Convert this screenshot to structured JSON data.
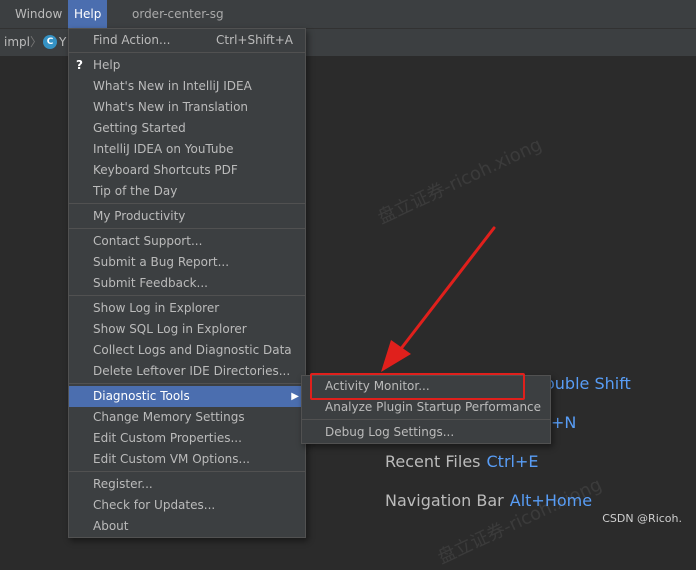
{
  "menubar": {
    "items": [
      {
        "label": "Window"
      },
      {
        "label": "Help"
      }
    ],
    "project_title": "order-center-sg"
  },
  "breadcrumb": {
    "items": [
      "impl",
      "Y"
    ],
    "class_icon": "C"
  },
  "help_menu": {
    "items": [
      {
        "label": "Find Action...",
        "shortcut": "Ctrl+Shift+A"
      },
      {
        "label": "Help"
      },
      {
        "label": "What's New in IntelliJ IDEA"
      },
      {
        "label": "What's New in Translation"
      },
      {
        "label": "Getting Started"
      },
      {
        "label": "IntelliJ IDEA on YouTube"
      },
      {
        "label": "Keyboard Shortcuts PDF"
      },
      {
        "label": "Tip of the Day"
      },
      {
        "label": "My Productivity"
      },
      {
        "label": "Contact Support..."
      },
      {
        "label": "Submit a Bug Report..."
      },
      {
        "label": "Submit Feedback..."
      },
      {
        "label": "Show Log in Explorer"
      },
      {
        "label": "Show SQL Log in Explorer"
      },
      {
        "label": "Collect Logs and Diagnostic Data"
      },
      {
        "label": "Delete Leftover IDE Directories..."
      },
      {
        "label": "Diagnostic Tools"
      },
      {
        "label": "Change Memory Settings"
      },
      {
        "label": "Edit Custom Properties..."
      },
      {
        "label": "Edit Custom VM Options..."
      },
      {
        "label": "Register..."
      },
      {
        "label": "Check for Updates..."
      },
      {
        "label": "About"
      }
    ]
  },
  "diagnostic_submenu": {
    "items": [
      {
        "label": "Activity Monitor..."
      },
      {
        "label": "Analyze Plugin Startup Performance"
      },
      {
        "label": "Debug Log Settings..."
      }
    ]
  },
  "editor_hints": {
    "search_everywhere_partial": "ouble Shift",
    "new_partial": "+N",
    "recent_files": {
      "label": "Recent Files",
      "key": "Ctrl+E"
    },
    "navigation_bar": {
      "label": "Navigation Bar",
      "key": "Alt+Home"
    }
  },
  "watermark": "盘立证券-ricoh.xiong",
  "credit": "CSDN @Ricoh.",
  "colors": {
    "menu_bg": "#3c3f41",
    "selection": "#4b6eaf",
    "shortcut_blue": "#589df6",
    "annotation_red": "#e0201c"
  },
  "icons": {
    "help": "question-mark-icon",
    "submenu": "chevron-right-icon",
    "class": "java-class-icon"
  }
}
